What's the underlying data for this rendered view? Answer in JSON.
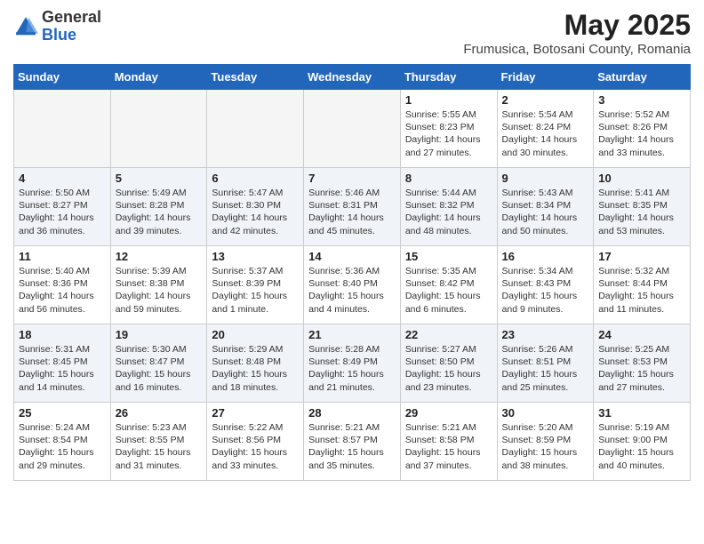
{
  "header": {
    "logo_general": "General",
    "logo_blue": "Blue",
    "main_title": "May 2025",
    "subtitle": "Frumusica, Botosani County, Romania"
  },
  "days_of_week": [
    "Sunday",
    "Monday",
    "Tuesday",
    "Wednesday",
    "Thursday",
    "Friday",
    "Saturday"
  ],
  "weeks": [
    {
      "row_class": "row-white",
      "cells": [
        {
          "empty": true
        },
        {
          "empty": true
        },
        {
          "empty": true
        },
        {
          "empty": true
        },
        {
          "day": 1,
          "info": "Sunrise: 5:55 AM\nSunset: 8:23 PM\nDaylight: 14 hours\nand 27 minutes."
        },
        {
          "day": 2,
          "info": "Sunrise: 5:54 AM\nSunset: 8:24 PM\nDaylight: 14 hours\nand 30 minutes."
        },
        {
          "day": 3,
          "info": "Sunrise: 5:52 AM\nSunset: 8:26 PM\nDaylight: 14 hours\nand 33 minutes."
        }
      ]
    },
    {
      "row_class": "row-blue",
      "cells": [
        {
          "day": 4,
          "info": "Sunrise: 5:50 AM\nSunset: 8:27 PM\nDaylight: 14 hours\nand 36 minutes."
        },
        {
          "day": 5,
          "info": "Sunrise: 5:49 AM\nSunset: 8:28 PM\nDaylight: 14 hours\nand 39 minutes."
        },
        {
          "day": 6,
          "info": "Sunrise: 5:47 AM\nSunset: 8:30 PM\nDaylight: 14 hours\nand 42 minutes."
        },
        {
          "day": 7,
          "info": "Sunrise: 5:46 AM\nSunset: 8:31 PM\nDaylight: 14 hours\nand 45 minutes."
        },
        {
          "day": 8,
          "info": "Sunrise: 5:44 AM\nSunset: 8:32 PM\nDaylight: 14 hours\nand 48 minutes."
        },
        {
          "day": 9,
          "info": "Sunrise: 5:43 AM\nSunset: 8:34 PM\nDaylight: 14 hours\nand 50 minutes."
        },
        {
          "day": 10,
          "info": "Sunrise: 5:41 AM\nSunset: 8:35 PM\nDaylight: 14 hours\nand 53 minutes."
        }
      ]
    },
    {
      "row_class": "row-white",
      "cells": [
        {
          "day": 11,
          "info": "Sunrise: 5:40 AM\nSunset: 8:36 PM\nDaylight: 14 hours\nand 56 minutes."
        },
        {
          "day": 12,
          "info": "Sunrise: 5:39 AM\nSunset: 8:38 PM\nDaylight: 14 hours\nand 59 minutes."
        },
        {
          "day": 13,
          "info": "Sunrise: 5:37 AM\nSunset: 8:39 PM\nDaylight: 15 hours\nand 1 minute."
        },
        {
          "day": 14,
          "info": "Sunrise: 5:36 AM\nSunset: 8:40 PM\nDaylight: 15 hours\nand 4 minutes."
        },
        {
          "day": 15,
          "info": "Sunrise: 5:35 AM\nSunset: 8:42 PM\nDaylight: 15 hours\nand 6 minutes."
        },
        {
          "day": 16,
          "info": "Sunrise: 5:34 AM\nSunset: 8:43 PM\nDaylight: 15 hours\nand 9 minutes."
        },
        {
          "day": 17,
          "info": "Sunrise: 5:32 AM\nSunset: 8:44 PM\nDaylight: 15 hours\nand 11 minutes."
        }
      ]
    },
    {
      "row_class": "row-blue",
      "cells": [
        {
          "day": 18,
          "info": "Sunrise: 5:31 AM\nSunset: 8:45 PM\nDaylight: 15 hours\nand 14 minutes."
        },
        {
          "day": 19,
          "info": "Sunrise: 5:30 AM\nSunset: 8:47 PM\nDaylight: 15 hours\nand 16 minutes."
        },
        {
          "day": 20,
          "info": "Sunrise: 5:29 AM\nSunset: 8:48 PM\nDaylight: 15 hours\nand 18 minutes."
        },
        {
          "day": 21,
          "info": "Sunrise: 5:28 AM\nSunset: 8:49 PM\nDaylight: 15 hours\nand 21 minutes."
        },
        {
          "day": 22,
          "info": "Sunrise: 5:27 AM\nSunset: 8:50 PM\nDaylight: 15 hours\nand 23 minutes."
        },
        {
          "day": 23,
          "info": "Sunrise: 5:26 AM\nSunset: 8:51 PM\nDaylight: 15 hours\nand 25 minutes."
        },
        {
          "day": 24,
          "info": "Sunrise: 5:25 AM\nSunset: 8:53 PM\nDaylight: 15 hours\nand 27 minutes."
        }
      ]
    },
    {
      "row_class": "row-white",
      "cells": [
        {
          "day": 25,
          "info": "Sunrise: 5:24 AM\nSunset: 8:54 PM\nDaylight: 15 hours\nand 29 minutes."
        },
        {
          "day": 26,
          "info": "Sunrise: 5:23 AM\nSunset: 8:55 PM\nDaylight: 15 hours\nand 31 minutes."
        },
        {
          "day": 27,
          "info": "Sunrise: 5:22 AM\nSunset: 8:56 PM\nDaylight: 15 hours\nand 33 minutes."
        },
        {
          "day": 28,
          "info": "Sunrise: 5:21 AM\nSunset: 8:57 PM\nDaylight: 15 hours\nand 35 minutes."
        },
        {
          "day": 29,
          "info": "Sunrise: 5:21 AM\nSunset: 8:58 PM\nDaylight: 15 hours\nand 37 minutes."
        },
        {
          "day": 30,
          "info": "Sunrise: 5:20 AM\nSunset: 8:59 PM\nDaylight: 15 hours\nand 38 minutes."
        },
        {
          "day": 31,
          "info": "Sunrise: 5:19 AM\nSunset: 9:00 PM\nDaylight: 15 hours\nand 40 minutes."
        }
      ]
    }
  ]
}
